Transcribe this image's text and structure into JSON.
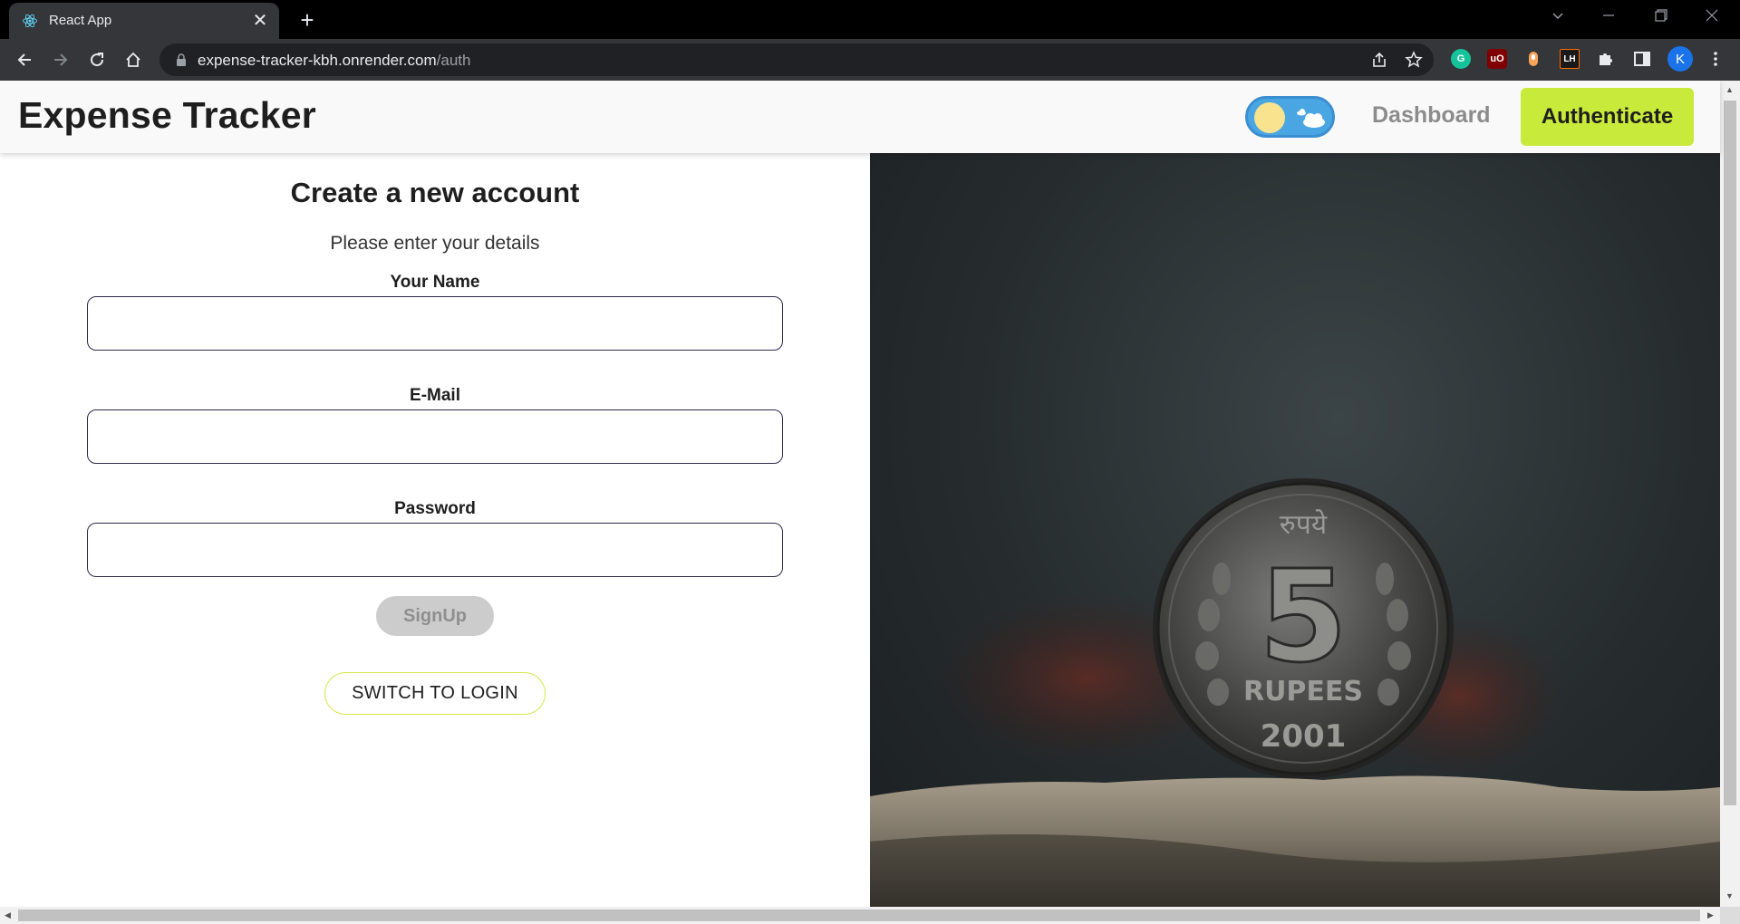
{
  "browser": {
    "tab_title": "React App",
    "tab_close": "✕",
    "new_tab": "+",
    "url_host": "expense-tracker-kbh.onrender.com",
    "url_path": "/auth",
    "profile_initial": "K",
    "ext_lh": "LH",
    "ext_ub": "uO"
  },
  "header": {
    "brand": "Expense Tracker",
    "nav_dashboard": "Dashboard",
    "nav_authenticate": "Authenticate"
  },
  "form": {
    "title": "Create a new account",
    "subtitle": "Please enter your details",
    "name_label": "Your Name",
    "name_value": "",
    "email_label": "E-Mail",
    "email_value": "",
    "password_label": "Password",
    "password_value": "",
    "signup_label": "SignUp",
    "switch_label": "SWITCH TO LOGIN"
  },
  "hero": {
    "coin_script": "रुपये",
    "coin_denomination": "5",
    "coin_word": "RUPEES",
    "coin_year": "2001"
  },
  "colors": {
    "accent": "#c8ea3a",
    "disabled_button": "#cccccc",
    "input_border": "#2c2a4a"
  }
}
